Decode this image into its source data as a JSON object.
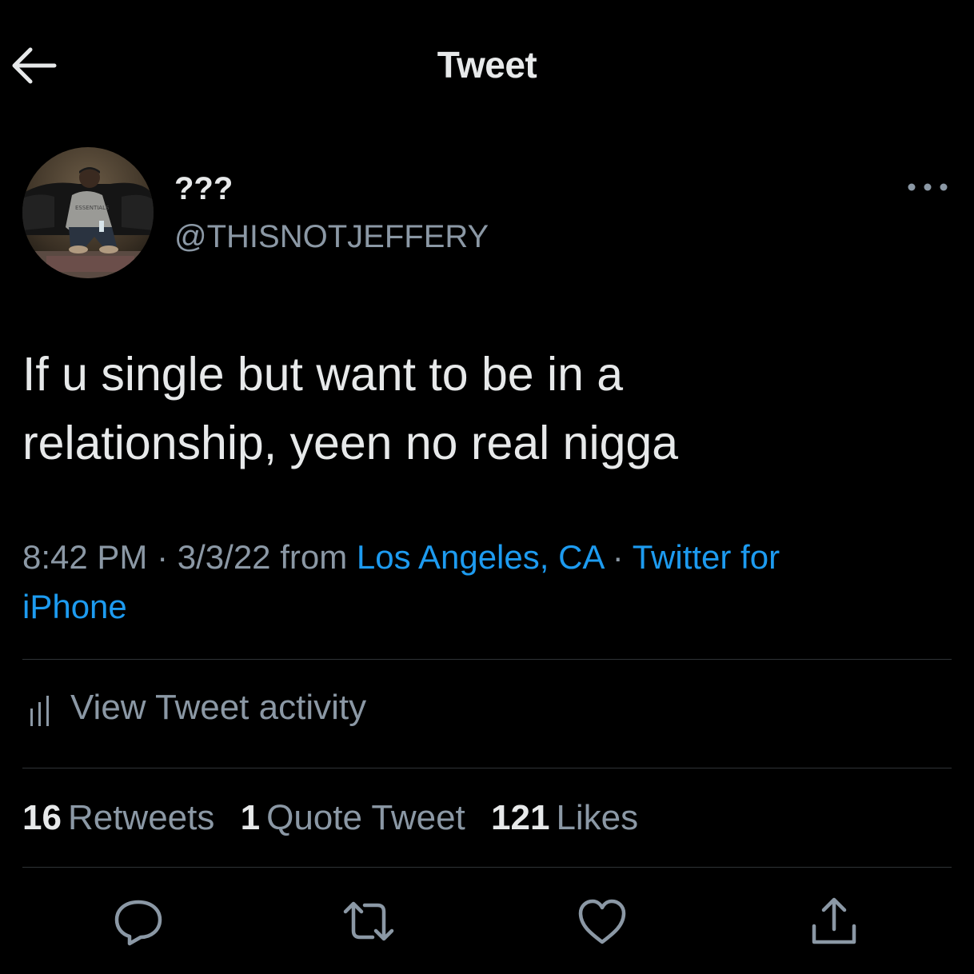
{
  "header": {
    "title": "Tweet",
    "back_icon": "arrow-left-icon"
  },
  "author": {
    "display_name": "???",
    "handle": "@THISNOTJEFFERY",
    "more_icon": "more-horizontal-icon"
  },
  "tweet": {
    "line1": "If u single but want to be in a",
    "line2": "relationship, yeen no real nigga"
  },
  "meta": {
    "time": "8:42 PM",
    "separator": "·",
    "date": "3/3/22",
    "from": "from",
    "location": "Los Angeles, CA",
    "source_part1": "Twitter for",
    "source_part2": "iPhone"
  },
  "activity": {
    "label": "View Tweet activity",
    "icon": "bar-chart-icon"
  },
  "stats": {
    "retweets_count": "16",
    "retweets_label": "Retweets",
    "quotes_count": "1",
    "quotes_label": "Quote Tweet",
    "likes_count": "121",
    "likes_label": "Likes"
  },
  "actions": {
    "reply_icon": "reply-icon",
    "retweet_icon": "retweet-icon",
    "like_icon": "heart-icon",
    "share_icon": "share-icon"
  },
  "colors": {
    "background": "#000000",
    "text": "#e7e9ea",
    "secondary": "#8b98a5",
    "link": "#1d9bf0",
    "divider": "#2f3336"
  }
}
